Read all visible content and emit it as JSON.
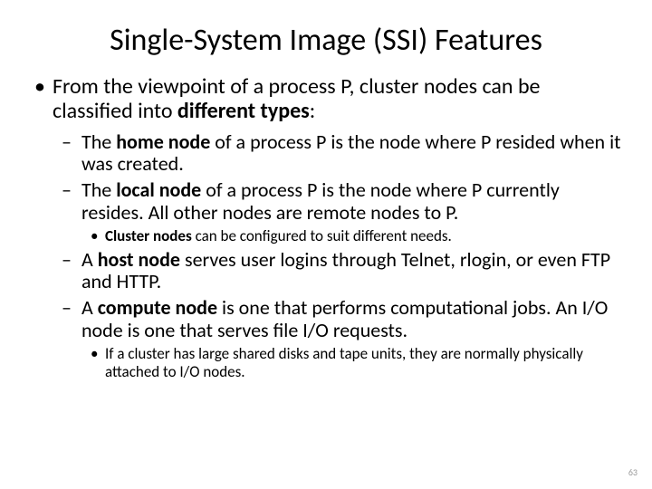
{
  "title": "Single-System Image (SSI) Features",
  "top_prefix": "From the viewpoint of a process P, cluster nodes can be classified into ",
  "top_bold": "different types",
  "top_suffix": ":",
  "a_pre": "The ",
  "a_bold": "home node",
  "a_post": " of a process P is the node where P resided when it was created.",
  "b_pre": "The ",
  "b_bold": "local node",
  "b_post": " of a process P is the node where P currently resides. All other nodes are remote nodes to P.",
  "b_sub_bold": "Cluster nodes",
  "b_sub_post": " can be configured to suit different needs.",
  "c_pre": "A ",
  "c_bold": "host node",
  "c_post": " serves user logins through Telnet, rlogin, or even FTP and HTTP.",
  "d_pre": "A ",
  "d_bold": "compute node",
  "d_post": " is one that performs computational jobs. An I/O node is one that  serves file I/O requests.",
  "d_sub": "If a cluster has large shared disks and tape units, they are normally physically attached to I/O nodes.",
  "page": "63"
}
